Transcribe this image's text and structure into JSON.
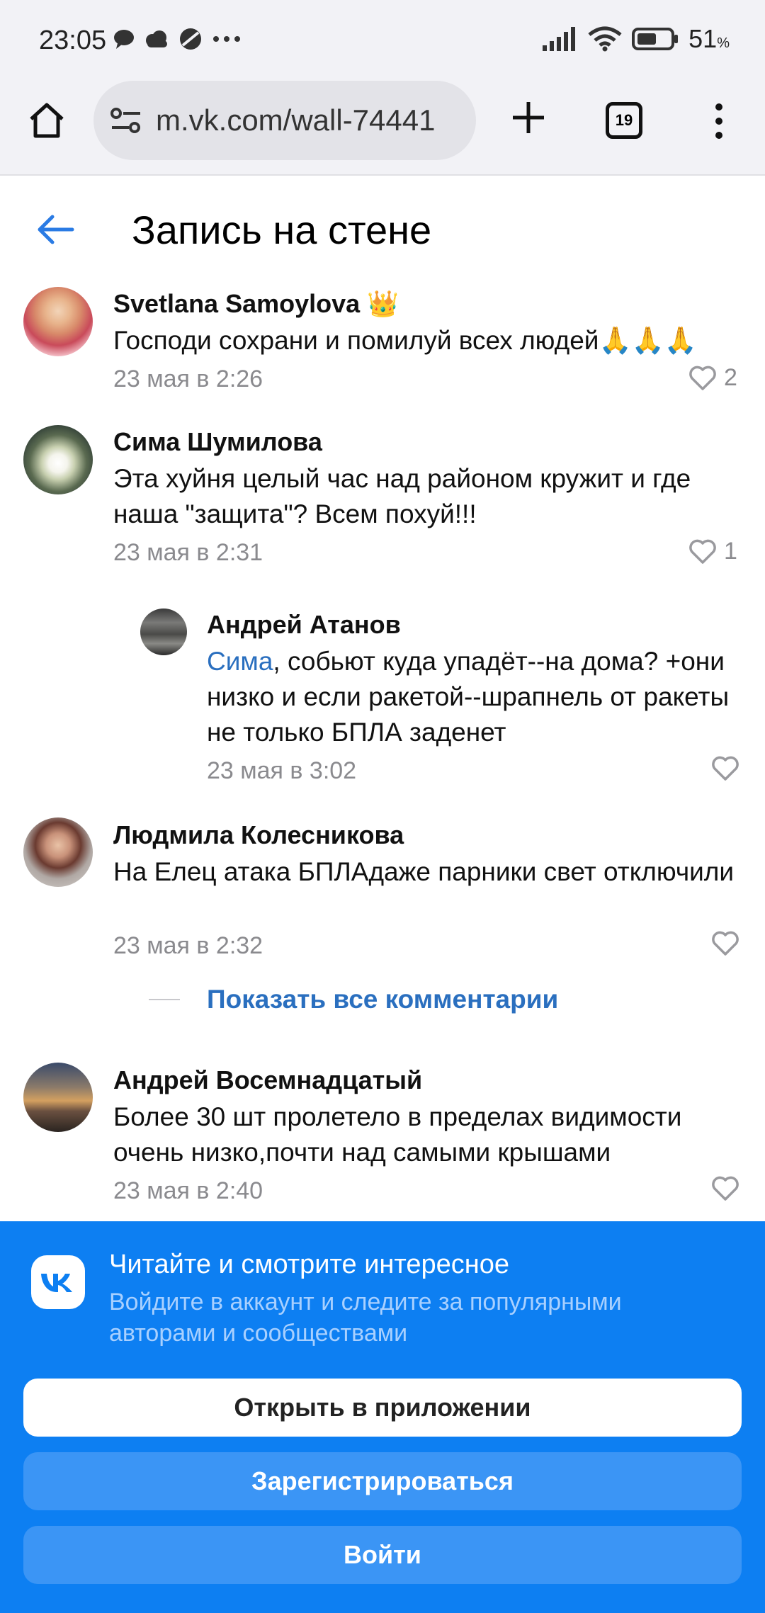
{
  "status_bar": {
    "time": "23:05",
    "battery": "51",
    "battery_unit": "%"
  },
  "browser": {
    "url": "m.vk.com/wall-74441",
    "tabs_count": "19"
  },
  "page": {
    "title": "Запись на стене"
  },
  "comments": [
    {
      "author": "Svetlana Samoylova",
      "badge": "👑",
      "text": "Господи сохрани и помилуй всех людей🙏🙏🙏",
      "date": "23 мая в 2:26",
      "likes": "2"
    },
    {
      "author": "Сима Шумилова",
      "text": "Эта хуйня целый час над районом кружит и где наша \"защита\"? Всем похуй!!!",
      "date": "23 мая в 2:31",
      "likes": "1"
    },
    {
      "author": "Андрей Атанов",
      "mention": "Сима",
      "text": ", собьют куда упадёт--на дома? +они низко и если ракетой--шрапнель от ракеты не только БПЛА заденет",
      "date": "23 мая в 3:02",
      "likes": ""
    },
    {
      "author": "Людмила Колесникова",
      "text": "На Елец атака БПЛАдаже парники свет отключили",
      "date": "23 мая в 2:32",
      "likes": ""
    },
    {
      "author": "Андрей Восемнадцатый",
      "text": "Более 30 шт пролетело в пределах видимости очень низко,почти над самыми крышами",
      "date": "23 мая в 2:40",
      "likes": ""
    }
  ],
  "show_all": "Показать все комментарии",
  "promo": {
    "title": "Читайте и смотрите интересное",
    "subtitle": "Войдите в аккаунт и следите за популярными авторами и сообществами",
    "open_app": "Открыть в приложении",
    "register": "Зарегистрироваться",
    "login": "Войти"
  }
}
